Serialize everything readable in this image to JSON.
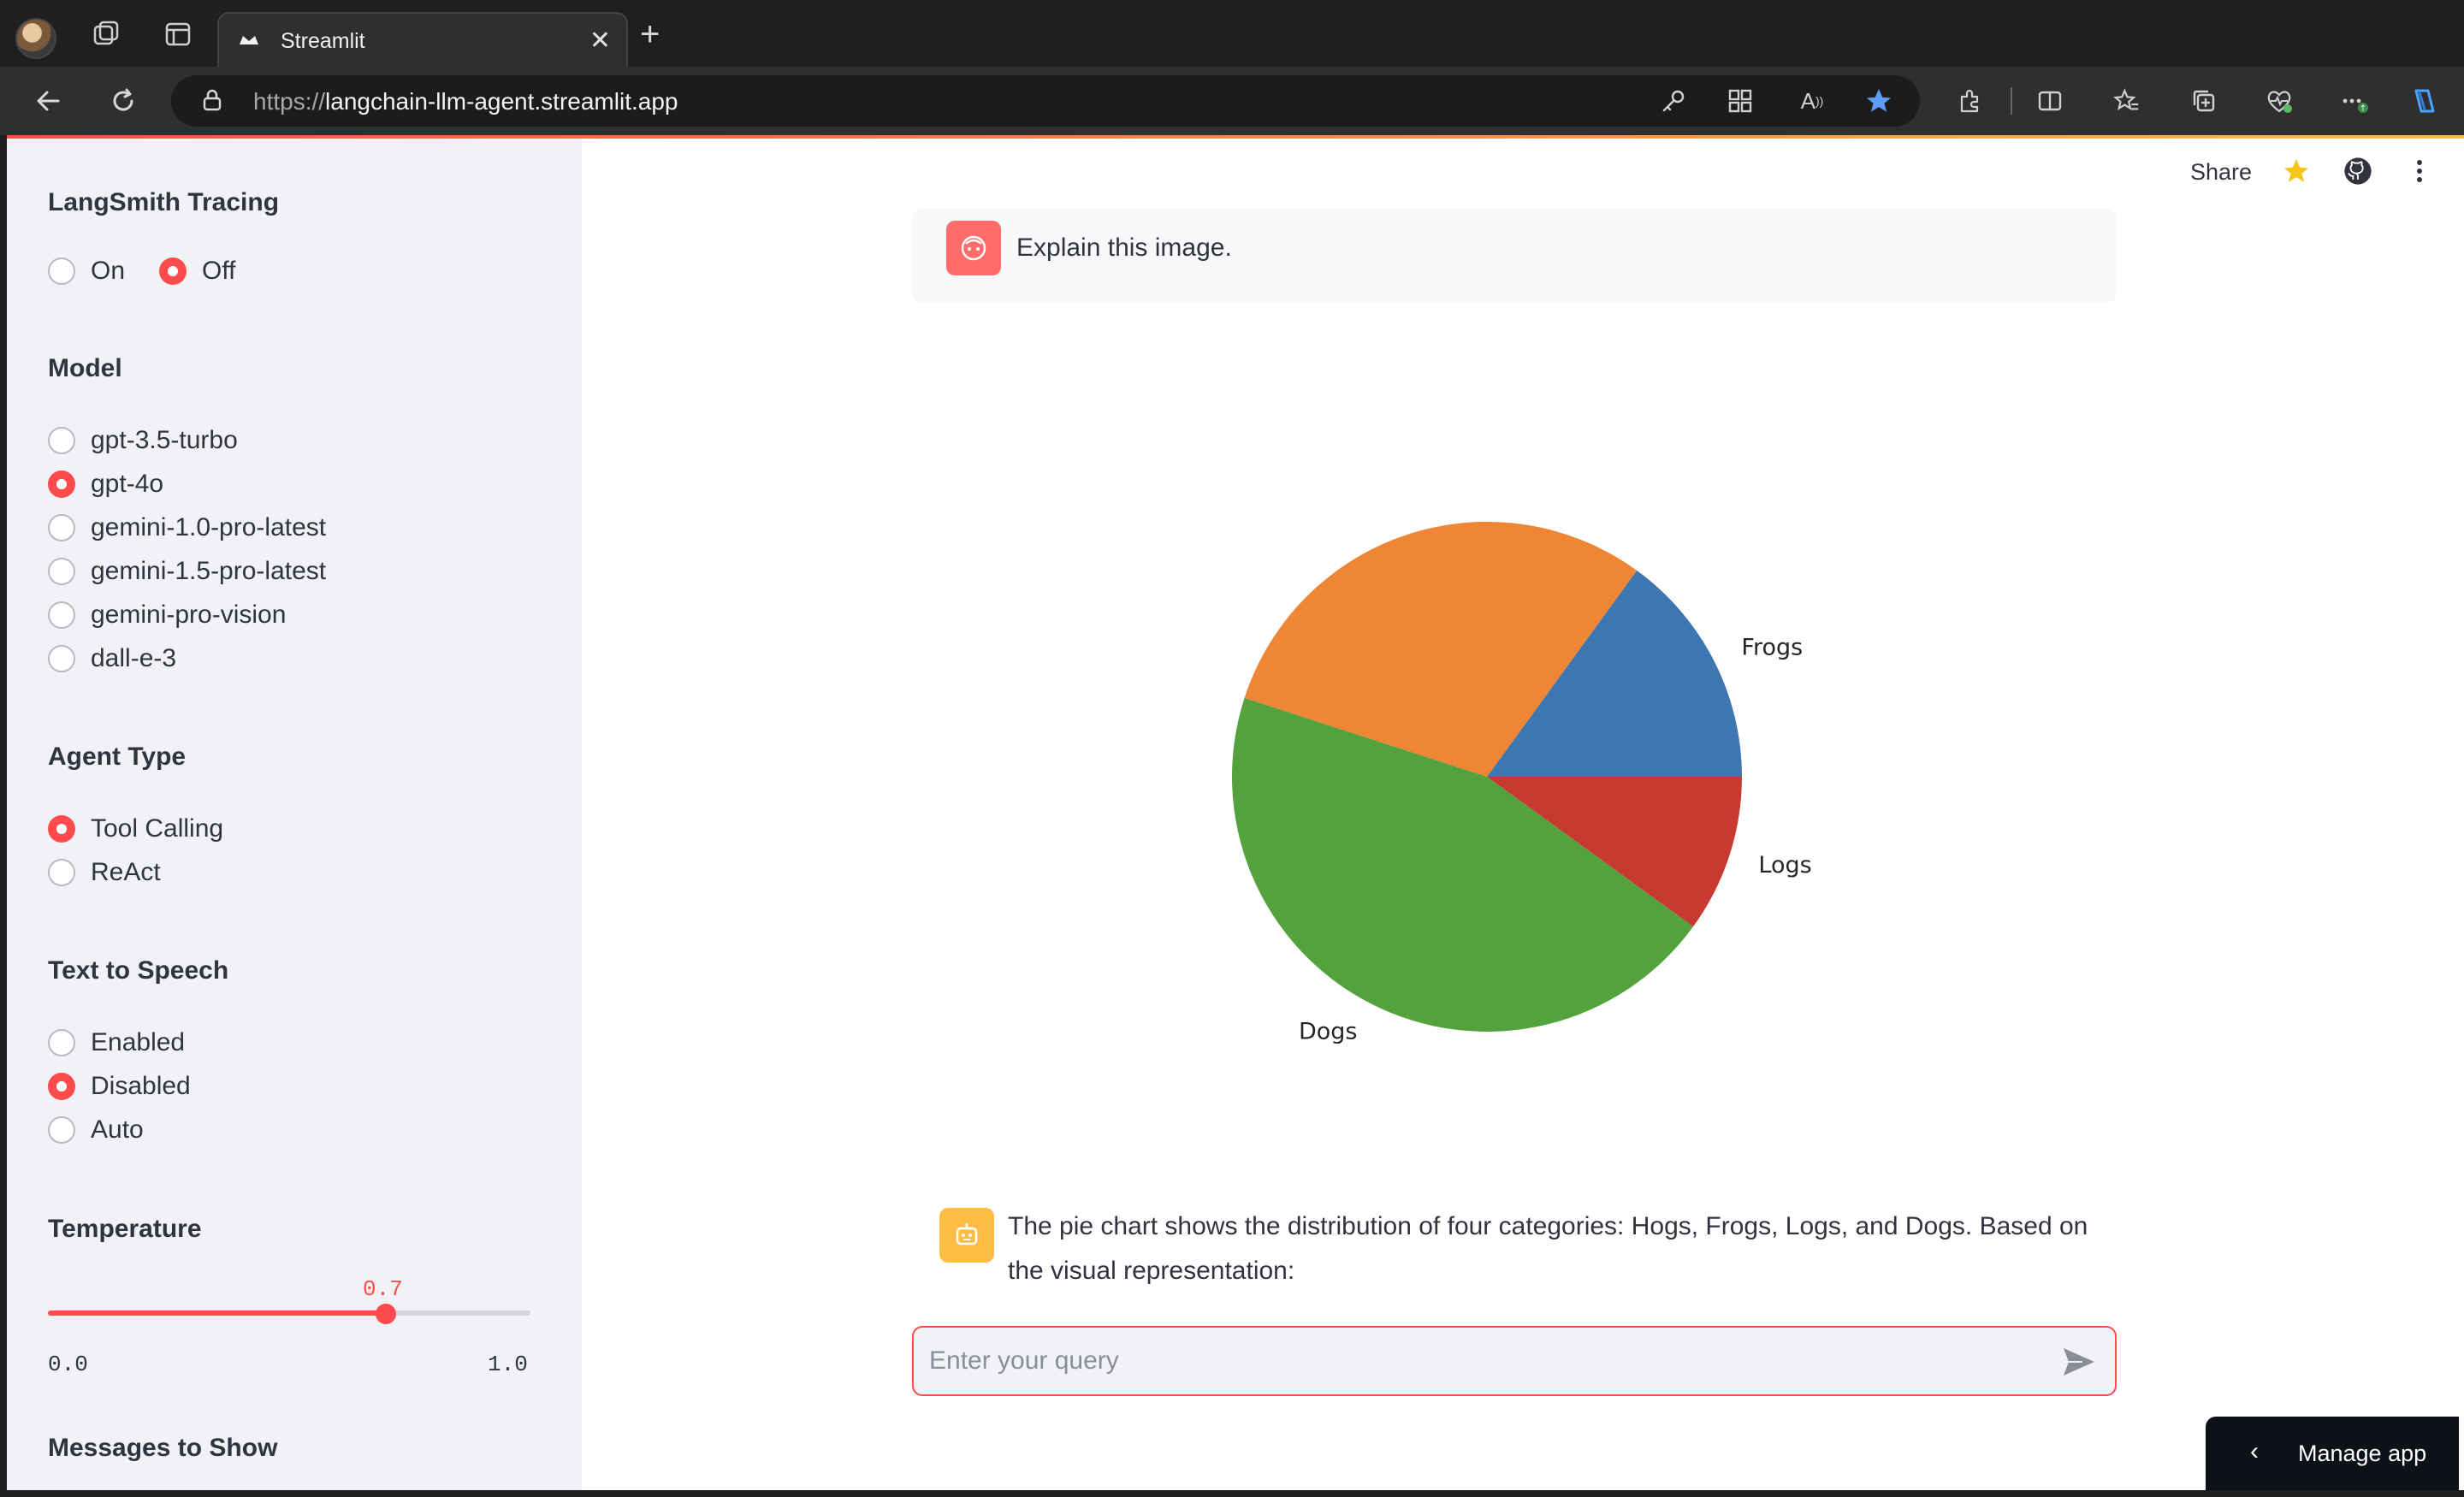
{
  "browser": {
    "tab_title": "Streamlit",
    "url_scheme": "https://",
    "url_host": "langchain-llm-agent.streamlit.app"
  },
  "sidebar": {
    "tracing": {
      "heading": "LangSmith Tracing",
      "options": [
        "On",
        "Off"
      ],
      "selected": "Off"
    },
    "model": {
      "heading": "Model",
      "options": [
        "gpt-3.5-turbo",
        "gpt-4o",
        "gemini-1.0-pro-latest",
        "gemini-1.5-pro-latest",
        "gemini-pro-vision",
        "dall-e-3"
      ],
      "selected": "gpt-4o"
    },
    "agent_type": {
      "heading": "Agent Type",
      "options": [
        "Tool Calling",
        "ReAct"
      ],
      "selected": "Tool Calling"
    },
    "tts": {
      "heading": "Text to Speech",
      "options": [
        "Enabled",
        "Disabled",
        "Auto"
      ],
      "selected": "Disabled"
    },
    "temperature": {
      "heading": "Temperature",
      "value": 0.7,
      "value_label": "0.7",
      "min_label": "0.0",
      "max_label": "1.0",
      "min": 0.0,
      "max": 1.0
    },
    "messages": {
      "heading": "Messages to Show"
    }
  },
  "header": {
    "share_label": "Share"
  },
  "chat": {
    "user_message": "Explain this image.",
    "assistant_message": "The pie chart shows the distribution of four categories: Hogs, Frogs, Logs, and Dogs. Based on the visual representation:",
    "input_placeholder": "Enter your query"
  },
  "chart_data": {
    "type": "pie",
    "categories": [
      "Frogs",
      "Hogs",
      "Dogs",
      "Logs"
    ],
    "values": [
      15,
      30,
      45,
      10
    ],
    "colors": [
      "#3d76b0",
      "#ee8636",
      "#53a23d",
      "#c63a32"
    ],
    "title": ""
  },
  "manage_app": {
    "label": "Manage app"
  }
}
